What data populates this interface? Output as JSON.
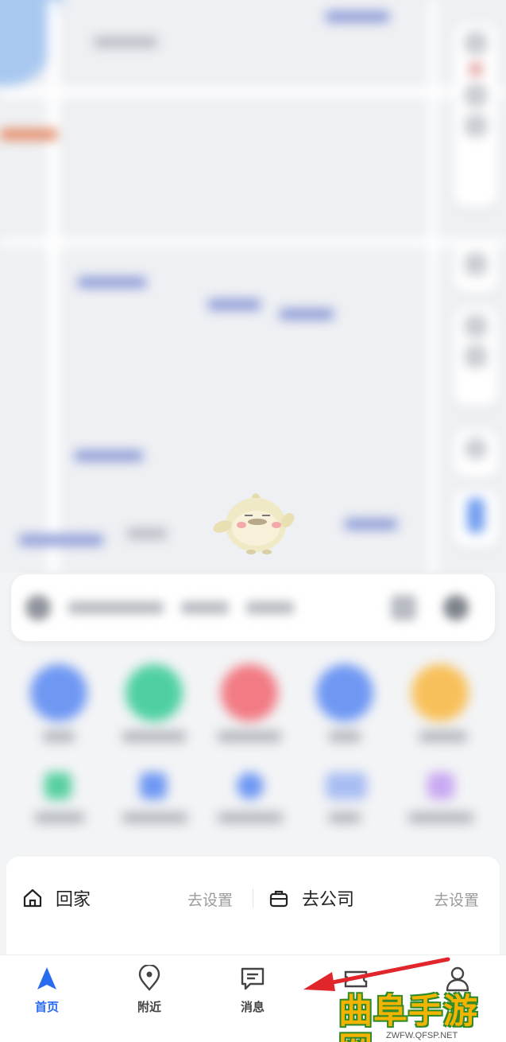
{
  "card": {
    "home": {
      "title": "回家",
      "action": "去设置"
    },
    "work": {
      "title": "去公司",
      "action": "去设置"
    }
  },
  "tabs": [
    {
      "label": "首页",
      "icon": "navigation-arrow-icon",
      "active": true
    },
    {
      "label": "附近",
      "icon": "location-pin-icon",
      "active": false
    },
    {
      "label": "消息",
      "icon": "message-icon",
      "active": false
    },
    {
      "label": "",
      "icon": "ticket-icon",
      "active": false
    },
    {
      "label": "",
      "icon": "user-icon",
      "active": false
    }
  ],
  "watermark": {
    "title": "曲阜手游网",
    "url": "ZWFW.QFSP.NET"
  },
  "colors": {
    "accent": "#2a6cf0",
    "annotation_arrow": "#e0262a",
    "watermark_text": "#f2b400",
    "watermark_outline": "#2f8a2a"
  }
}
